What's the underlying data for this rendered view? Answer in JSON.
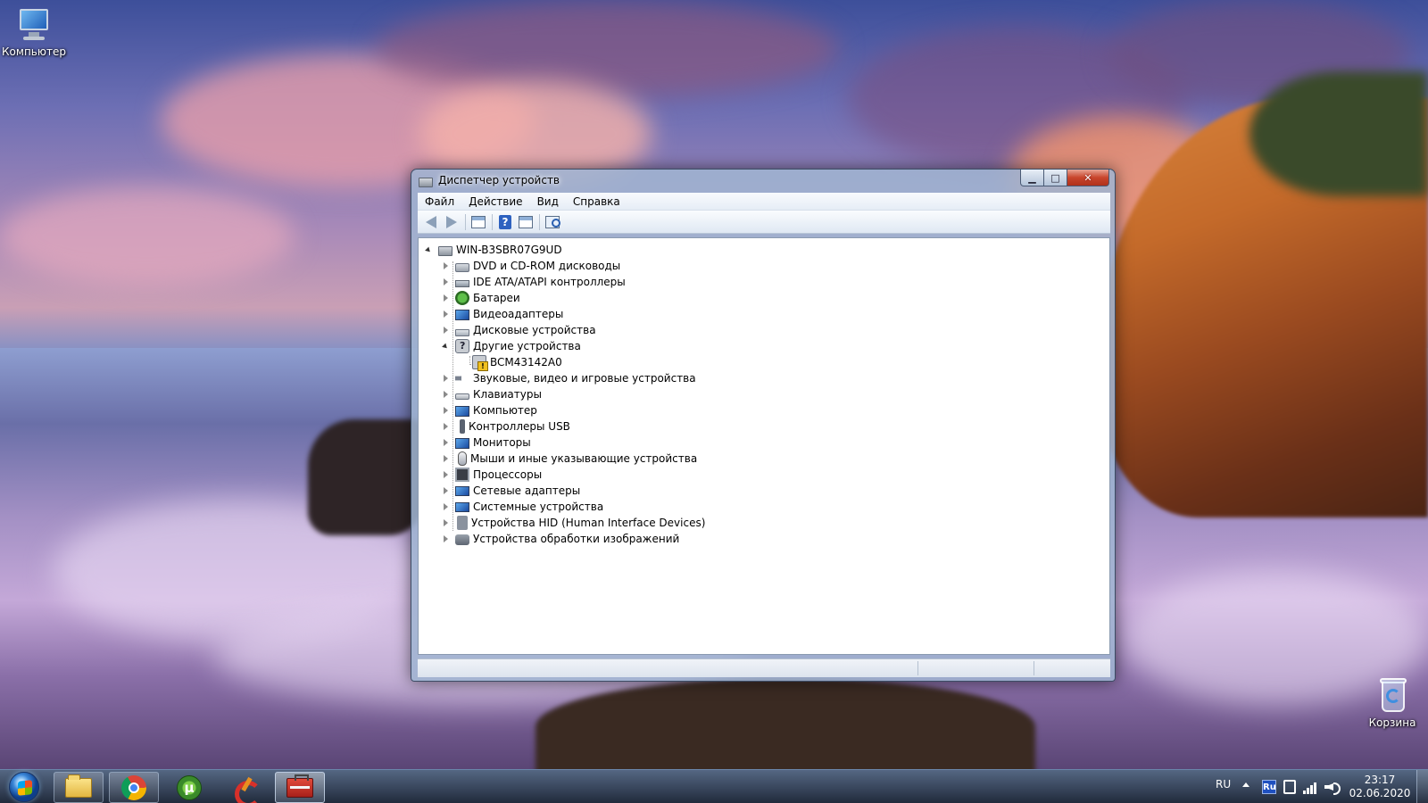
{
  "desktop": {
    "icons": [
      {
        "label": "Компьютер",
        "icon": "computer-icon"
      },
      {
        "label": "Корзина",
        "icon": "recycle-bin-icon"
      }
    ]
  },
  "window": {
    "title": "Диспетчер устройств",
    "menu": [
      "Файл",
      "Действие",
      "Вид",
      "Справка"
    ],
    "caption_buttons": {
      "minimize": "▁",
      "maximize": "□",
      "close": "✕"
    },
    "toolbar": [
      "back-icon",
      "forward-icon",
      "properties-icon",
      "help-icon",
      "update-driver-icon",
      "scan-hardware-icon"
    ],
    "tree": {
      "root": "WIN-B3SBR07G9UD",
      "categories": [
        {
          "label": "DVD и CD-ROM дисководы",
          "icon": "dvd-drive-icon",
          "expanded": false
        },
        {
          "label": "IDE ATA/ATAPI контроллеры",
          "icon": "ide-controller-icon",
          "expanded": false
        },
        {
          "label": "Батареи",
          "icon": "battery-icon",
          "expanded": false
        },
        {
          "label": "Видеоадаптеры",
          "icon": "display-adapter-icon",
          "expanded": false
        },
        {
          "label": "Дисковые устройства",
          "icon": "disk-drive-icon",
          "expanded": false
        },
        {
          "label": "Другие устройства",
          "icon": "other-devices-icon",
          "expanded": true,
          "children": [
            {
              "label": "BCM43142A0",
              "icon": "warning-device-icon"
            }
          ]
        },
        {
          "label": "Звуковые, видео и игровые устройства",
          "icon": "sound-icon",
          "expanded": false
        },
        {
          "label": "Клавиатуры",
          "icon": "keyboard-icon",
          "expanded": false
        },
        {
          "label": "Компьютер",
          "icon": "computer-icon",
          "expanded": false
        },
        {
          "label": "Контроллеры USB",
          "icon": "usb-icon",
          "expanded": false
        },
        {
          "label": "Мониторы",
          "icon": "monitor-icon",
          "expanded": false
        },
        {
          "label": "Мыши и иные указывающие устройства",
          "icon": "mouse-icon",
          "expanded": false
        },
        {
          "label": "Процессоры",
          "icon": "processor-icon",
          "expanded": false
        },
        {
          "label": "Сетевые адаптеры",
          "icon": "network-adapter-icon",
          "expanded": false
        },
        {
          "label": "Системные устройства",
          "icon": "system-devices-icon",
          "expanded": false
        },
        {
          "label": "Устройства HID (Human Interface Devices)",
          "icon": "hid-icon",
          "expanded": false
        },
        {
          "label": "Устройства обработки изображений",
          "icon": "imaging-icon",
          "expanded": false
        }
      ]
    }
  },
  "taskbar": {
    "pinned": [
      "windows-explorer-icon",
      "chrome-icon",
      "utorrent-icon",
      "ccleaner-icon",
      "device-manager-icon"
    ],
    "tray": {
      "language": "RU",
      "input_indicator": "Ru",
      "time": "23:17",
      "date": "02.06.2020"
    }
  }
}
